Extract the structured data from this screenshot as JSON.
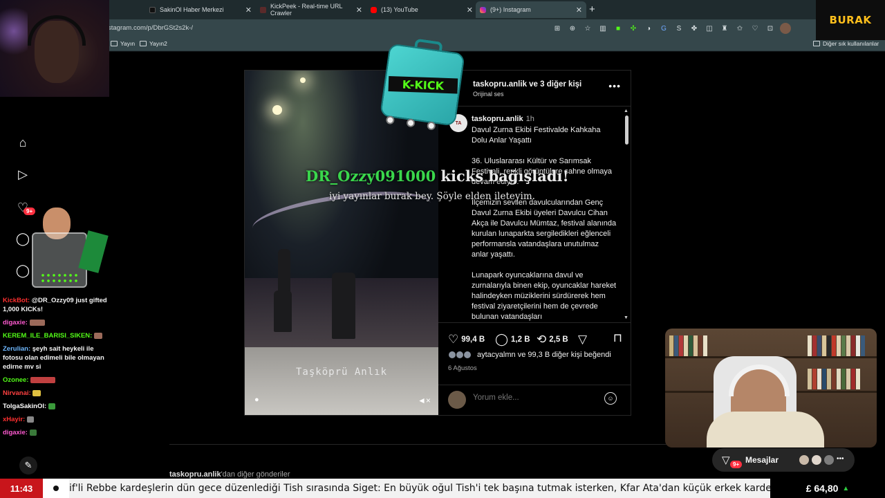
{
  "browser": {
    "tabs": [
      {
        "label": "SakinOl Haber Merkezi",
        "fav_color": "#111111"
      },
      {
        "label": "KickPeek - Real-time URL Crawler",
        "fav_color": "#5a2a2a"
      },
      {
        "label": "(13) YouTube",
        "fav_color": "#ff0000"
      },
      {
        "label": "(9+) Instagram",
        "fav_color": "#d6249f"
      }
    ],
    "url": "stagram.com/p/DbrGSt2s2k-/",
    "bookmarks": [
      "Yayın",
      "Yayın2"
    ],
    "bookmarks_right": "Diğer sık kullanılanlar",
    "new_tab": "+"
  },
  "post": {
    "header_user": "taskopru.anlik ve 3 diğer kişi",
    "header_sub": "Orijinal ses",
    "more": "•••",
    "caption_user": "taskopru.anlik",
    "caption_time": "1h",
    "caption_avatar": "TA",
    "caption_paragraphs": [
      "Davul Zurna Ekibi Festivalde Kahkaha Dolu Anlar Yaşattı",
      "36. Uluslararası Kültür ve Sarımsak Festivali, renkli görüntülere sahne olmaya devam ediyor.",
      "İlçemizin sevilen davulcularından Genç Davul Zurna Ekibi üyeleri Davulcu Cihan Akça ile Davulcu Mümtaz, festival alanında kurulan lunaparkta sergiledikleri eğlenceli performansla vatandaşlara unutulmaz anlar yaşattı.",
      "Lunapark oyuncaklarına davul ve zurnalarıyla binen ekip, oyuncaklar hareket halindeyken müziklerini sürdürerek hem festival ziyaretçilerini hem de çevrede bulunan vatandaşları"
    ],
    "likes": "99,4 B",
    "comments": "1,2 B",
    "reposts": "2,5 B",
    "liked_by": "aytacyalmn ve 99,3 B diğer kişi beğendi",
    "date": "6 Ağustos",
    "comment_placeholder": "Yorum ekle...",
    "video_watermark": "Taşköprü Anlık",
    "more_posts_user": "taskopru.anlik",
    "more_posts_suffix": "'dan diğer gönderiler"
  },
  "nav": {
    "notifications_badge": "9+"
  },
  "messages": {
    "label": "Mesajlar",
    "badge": "9+",
    "more": "•••"
  },
  "stream": {
    "logo": "BURAK",
    "kick_donor": "DR_Ozzy091000",
    "kick_text": " kicks bağışladı!",
    "kick_message": "iyi yayınlar burak bey. Şöyle elden ileteyim.",
    "suitcase_label": "K-KICK",
    "chat": [
      {
        "user": "KickBot:",
        "text": " @DR_Ozzy09 just gifted 1,000 KICKs!",
        "color": "#ff3030"
      },
      {
        "user": "digaxie:",
        "text": "",
        "color": "#ff5ad1"
      },
      {
        "user": "KEREM_ILE_BARISI_SIKEN:",
        "text": "",
        "color": "#53fc18"
      },
      {
        "user": "Zerulian:",
        "text": " şeyh sait heykeli ile fotosu olan edimeli bile olmayan edirne mv si",
        "color": "#6fb8ff"
      },
      {
        "user": "Ozonee:",
        "text": "",
        "color": "#53fc18"
      },
      {
        "user": "Nirvanai:",
        "text": "",
        "color": "#ff4040"
      },
      {
        "user": "TolgaSakinOl:",
        "text": "",
        "color": "#ffffff"
      },
      {
        "user": "xHayir:",
        "text": "",
        "color": "#ff3030"
      },
      {
        "user": "digaxie:",
        "text": "",
        "color": "#ff5ad1"
      }
    ],
    "clock": "11:43",
    "ticker": "if'li Rebbe kardeşlerin dün gece düzenlediği Tish sırasında Siget: En büyük oğul Tish'i tek başına tutmak isterken, Kfar Ata'dan küçük erkek kardeşi Rebbe kıy",
    "price": "£ 64,80",
    "price_arrow": "▲"
  }
}
